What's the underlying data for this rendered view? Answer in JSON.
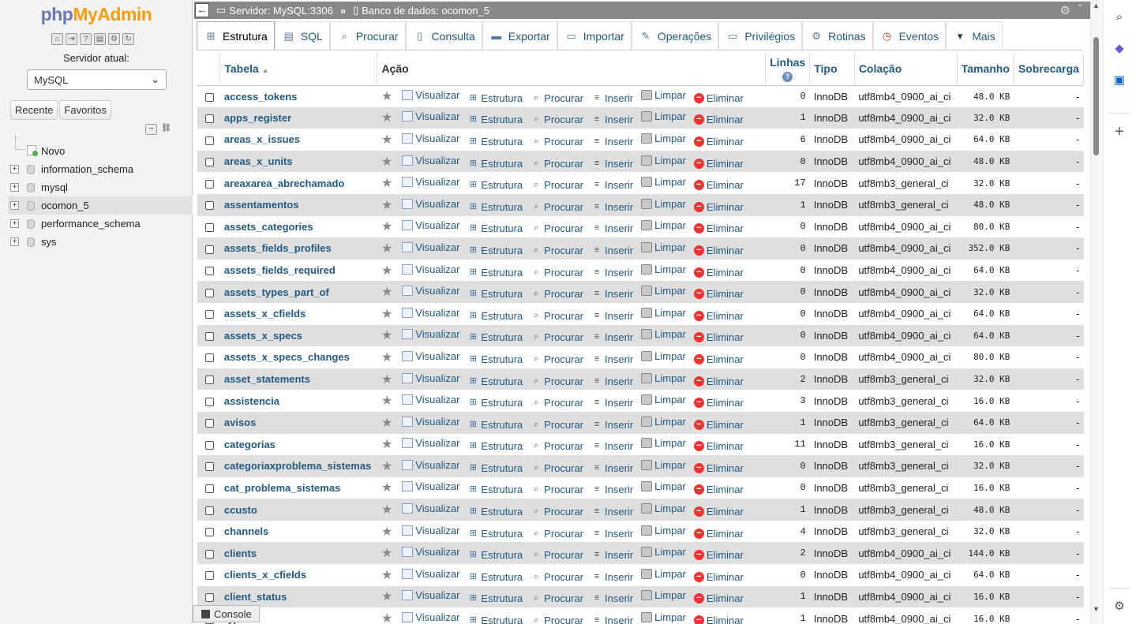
{
  "nav": {
    "logo_part1": "php",
    "logo_part2": "MyAdmin",
    "server_label": "Servidor atual:",
    "server_value": "MySQL",
    "tabs": [
      "Recente",
      "Favoritos"
    ],
    "tree": [
      {
        "label": "Novo",
        "type": "new"
      },
      {
        "label": "information_schema",
        "type": "db"
      },
      {
        "label": "mysql",
        "type": "db"
      },
      {
        "label": "ocomon_5",
        "type": "db",
        "selected": true
      },
      {
        "label": "performance_schema",
        "type": "db"
      },
      {
        "label": "sys",
        "type": "db"
      }
    ]
  },
  "breadcrumb": {
    "server": "Servidor: MySQL:3306",
    "separator": "»",
    "database": "Banco de dados: ocomon_5"
  },
  "tabs": [
    {
      "label": "Estrutura",
      "icon": "structure-icon",
      "active": true
    },
    {
      "label": "SQL",
      "icon": "sql-icon"
    },
    {
      "label": "Procurar",
      "icon": "search-icon"
    },
    {
      "label": "Consulta",
      "icon": "query-icon"
    },
    {
      "label": "Exportar",
      "icon": "export-icon"
    },
    {
      "label": "Importar",
      "icon": "import-icon"
    },
    {
      "label": "Operações",
      "icon": "wrench-icon"
    },
    {
      "label": "Privilégios",
      "icon": "privileges-icon"
    },
    {
      "label": "Rotinas",
      "icon": "routines-icon"
    },
    {
      "label": "Eventos",
      "icon": "clock-icon"
    },
    {
      "label": "Mais",
      "icon": "chevron-down-icon"
    }
  ],
  "table": {
    "headers": {
      "tabela": "Tabela",
      "acao": "Ação",
      "linhas": "Linhas",
      "tipo": "Tipo",
      "colacao": "Colação",
      "tamanho": "Tamanho",
      "sobrecarga": "Sobrecarga"
    },
    "actions": [
      "Visualizar",
      "Estrutura",
      "Procurar",
      "Inserir",
      "Limpar",
      "Eliminar"
    ],
    "rows": [
      {
        "name": "access_tokens",
        "rows": "0",
        "type": "InnoDB",
        "collation": "utf8mb4_0900_ai_ci",
        "size": "48.0 KB",
        "overhead": "-"
      },
      {
        "name": "apps_register",
        "rows": "1",
        "type": "InnoDB",
        "collation": "utf8mb4_0900_ai_ci",
        "size": "32.0 KB",
        "overhead": "-"
      },
      {
        "name": "areas_x_issues",
        "rows": "6",
        "type": "InnoDB",
        "collation": "utf8mb4_0900_ai_ci",
        "size": "64.0 KB",
        "overhead": "-"
      },
      {
        "name": "areas_x_units",
        "rows": "0",
        "type": "InnoDB",
        "collation": "utf8mb4_0900_ai_ci",
        "size": "48.0 KB",
        "overhead": "-"
      },
      {
        "name": "areaxarea_abrechamado",
        "rows": "17",
        "type": "InnoDB",
        "collation": "utf8mb3_general_ci",
        "size": "32.0 KB",
        "overhead": "-"
      },
      {
        "name": "assentamentos",
        "rows": "1",
        "type": "InnoDB",
        "collation": "utf8mb3_general_ci",
        "size": "48.0 KB",
        "overhead": "-"
      },
      {
        "name": "assets_categories",
        "rows": "0",
        "type": "InnoDB",
        "collation": "utf8mb4_0900_ai_ci",
        "size": "80.0 KB",
        "overhead": "-"
      },
      {
        "name": "assets_fields_profiles",
        "rows": "0",
        "type": "InnoDB",
        "collation": "utf8mb4_0900_ai_ci",
        "size": "352.0 KB",
        "overhead": "-"
      },
      {
        "name": "assets_fields_required",
        "rows": "0",
        "type": "InnoDB",
        "collation": "utf8mb4_0900_ai_ci",
        "size": "64.0 KB",
        "overhead": "-"
      },
      {
        "name": "assets_types_part_of",
        "rows": "0",
        "type": "InnoDB",
        "collation": "utf8mb4_0900_ai_ci",
        "size": "32.0 KB",
        "overhead": "-"
      },
      {
        "name": "assets_x_cfields",
        "rows": "0",
        "type": "InnoDB",
        "collation": "utf8mb4_0900_ai_ci",
        "size": "64.0 KB",
        "overhead": "-"
      },
      {
        "name": "assets_x_specs",
        "rows": "0",
        "type": "InnoDB",
        "collation": "utf8mb4_0900_ai_ci",
        "size": "64.0 KB",
        "overhead": "-"
      },
      {
        "name": "assets_x_specs_changes",
        "rows": "0",
        "type": "InnoDB",
        "collation": "utf8mb4_0900_ai_ci",
        "size": "80.0 KB",
        "overhead": "-"
      },
      {
        "name": "asset_statements",
        "rows": "2",
        "type": "InnoDB",
        "collation": "utf8mb3_general_ci",
        "size": "32.0 KB",
        "overhead": "-"
      },
      {
        "name": "assistencia",
        "rows": "3",
        "type": "InnoDB",
        "collation": "utf8mb3_general_ci",
        "size": "16.0 KB",
        "overhead": "-"
      },
      {
        "name": "avisos",
        "rows": "1",
        "type": "InnoDB",
        "collation": "utf8mb3_general_ci",
        "size": "64.0 KB",
        "overhead": "-"
      },
      {
        "name": "categorias",
        "rows": "11",
        "type": "InnoDB",
        "collation": "utf8mb3_general_ci",
        "size": "16.0 KB",
        "overhead": "-"
      },
      {
        "name": "categoriaxproblema_sistemas",
        "rows": "0",
        "type": "InnoDB",
        "collation": "utf8mb3_general_ci",
        "size": "32.0 KB",
        "overhead": "-"
      },
      {
        "name": "cat_problema_sistemas",
        "rows": "0",
        "type": "InnoDB",
        "collation": "utf8mb3_general_ci",
        "size": "16.0 KB",
        "overhead": "-"
      },
      {
        "name": "ccusto",
        "rows": "1",
        "type": "InnoDB",
        "collation": "utf8mb3_general_ci",
        "size": "48.0 KB",
        "overhead": "-"
      },
      {
        "name": "channels",
        "rows": "4",
        "type": "InnoDB",
        "collation": "utf8mb3_general_ci",
        "size": "32.0 KB",
        "overhead": "-"
      },
      {
        "name": "clients",
        "rows": "2",
        "type": "InnoDB",
        "collation": "utf8mb4_0900_ai_ci",
        "size": "144.0 KB",
        "overhead": "-"
      },
      {
        "name": "clients_x_cfields",
        "rows": "0",
        "type": "InnoDB",
        "collation": "utf8mb4_0900_ai_ci",
        "size": "64.0 KB",
        "overhead": "-"
      },
      {
        "name": "client_status",
        "rows": "1",
        "type": "InnoDB",
        "collation": "utf8mb4_0900_ai_ci",
        "size": "16.0 KB",
        "overhead": "-"
      },
      {
        "name": "types",
        "rows": "1",
        "type": "InnoDB",
        "collation": "utf8mb4_0900_ai_ci",
        "size": "16.0 KB",
        "overhead": "-"
      }
    ]
  },
  "console": {
    "label": "Console"
  }
}
